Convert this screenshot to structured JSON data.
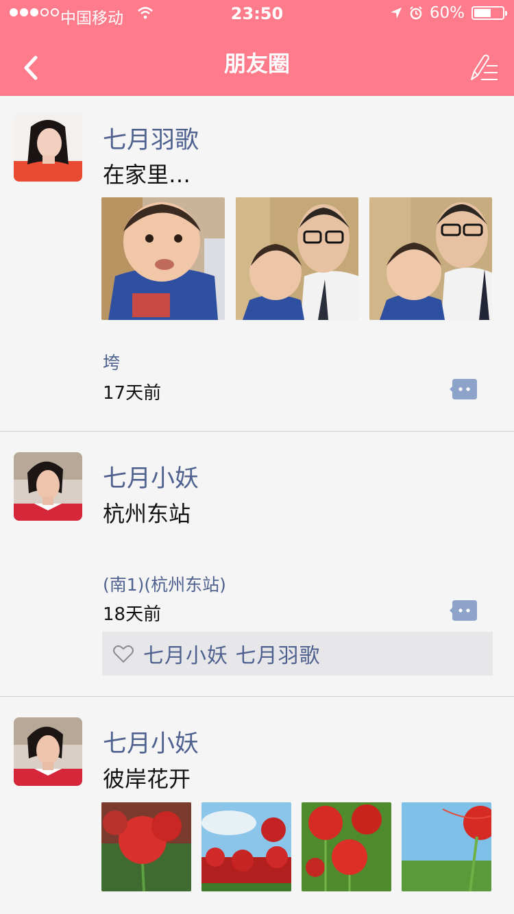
{
  "status_bar": {
    "carrier": "中国移动",
    "time": "23:50",
    "battery_text": "60%",
    "battery_level": 0.6
  },
  "nav": {
    "title": "朋友圈"
  },
  "posts": [
    {
      "name": "七月羽歌",
      "text": "在家里…",
      "location": "垮",
      "time": "17天前"
    },
    {
      "name": "七月小妖",
      "text": "杭州东站",
      "location": "(南1)(杭州东站)",
      "time": "18天前",
      "likes": "七月小妖  七月羽歌"
    },
    {
      "name": "七月小妖",
      "text": "彼岸花开"
    }
  ],
  "colors": {
    "header": "#fd7b8b",
    "name": "#4e618f",
    "comment_icon": "#8ea3c9"
  }
}
